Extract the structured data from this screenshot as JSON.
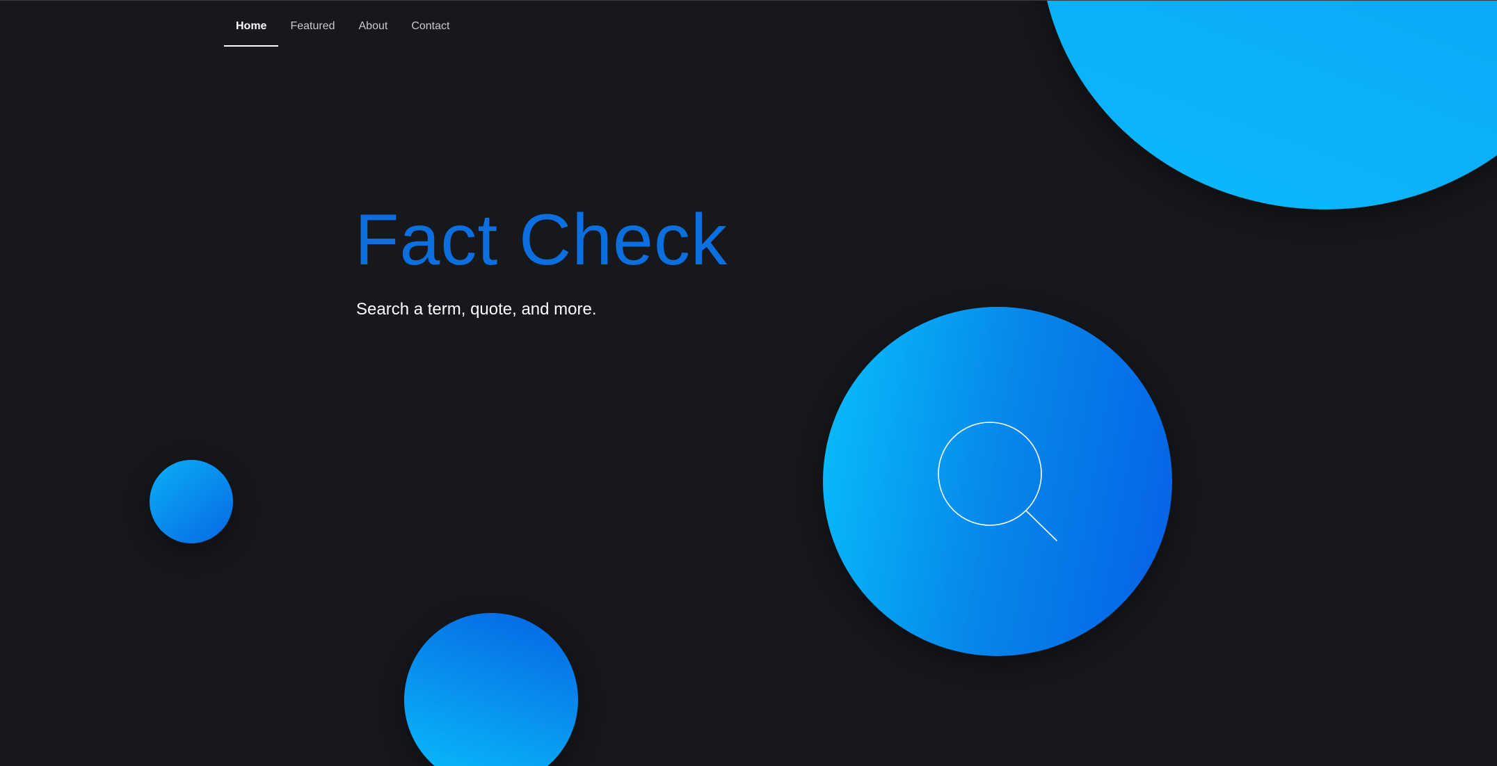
{
  "nav": {
    "items": [
      {
        "label": "Home",
        "active": true
      },
      {
        "label": "Featured",
        "active": false
      },
      {
        "label": "About",
        "active": false
      },
      {
        "label": "Contact",
        "active": false
      }
    ]
  },
  "hero": {
    "title": "Fact Check",
    "subtitle": "Search a term, quote, and more."
  },
  "icons": {
    "search": "search-icon"
  },
  "colors": {
    "background": "#17181c",
    "title": "#0b6fe0",
    "accent_light": "#08c0fb",
    "accent_dark": "#0660e6",
    "text": "#ffffff",
    "nav_text": "#c9cacd"
  }
}
